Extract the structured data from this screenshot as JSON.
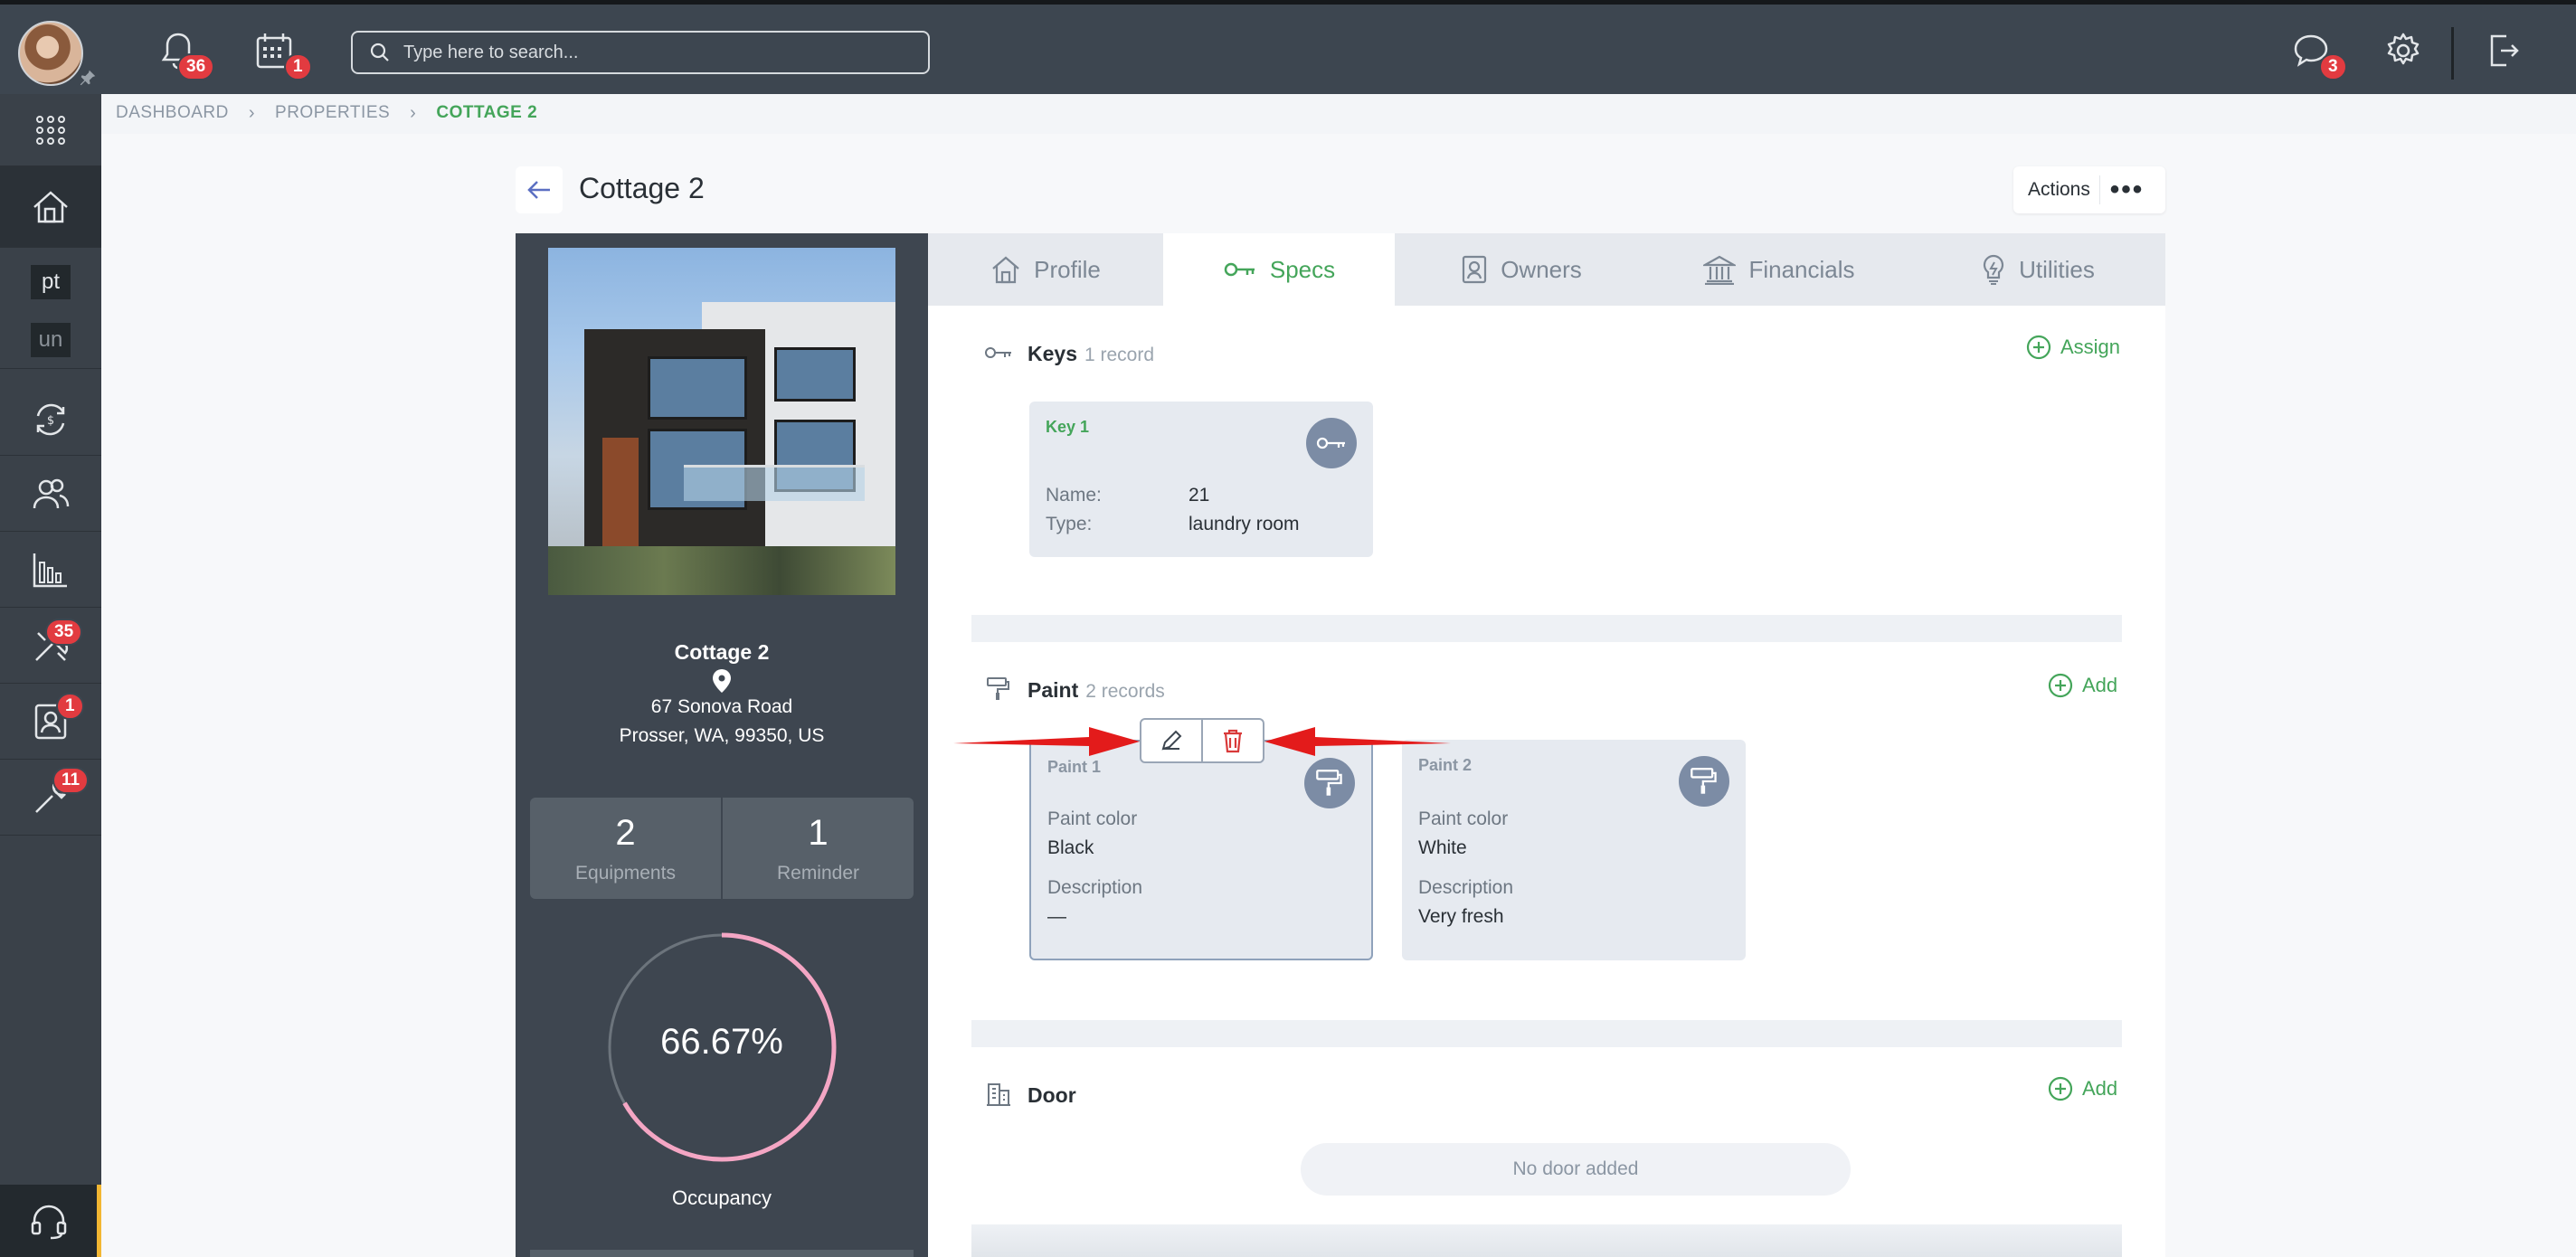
{
  "topbar": {
    "notifications_count": "36",
    "calendar_count": "1",
    "search_placeholder": "Type here to search...",
    "messages_count": "3"
  },
  "sidebar": {
    "pt_label": "pt",
    "un_label": "un",
    "maintenance_count": "35",
    "contacts_count": "1",
    "tools_count": "11"
  },
  "breadcrumb": {
    "items": [
      "DASHBOARD",
      "PROPERTIES",
      "COTTAGE 2"
    ]
  },
  "header": {
    "title": "Cottage 2",
    "actions_label": "Actions",
    "more_label": "•••"
  },
  "property": {
    "name": "Cottage 2",
    "address_line1": "67 Sonova Road",
    "address_line2": "Prosser, WA, 99350, US",
    "equipments_count": "2",
    "equipments_label": "Equipments",
    "reminder_count": "1",
    "reminder_label": "Reminder",
    "occupancy_value": "66.67%",
    "occupancy_fraction": 0.6667,
    "occupancy_label": "Occupancy"
  },
  "tabs": [
    {
      "label": "Profile"
    },
    {
      "label": "Specs"
    },
    {
      "label": "Owners"
    },
    {
      "label": "Financials"
    },
    {
      "label": "Utilities"
    }
  ],
  "keys": {
    "title": "Keys",
    "count": "1 record",
    "action": "Assign",
    "cards": [
      {
        "title": "Key 1",
        "name_label": "Name:",
        "name_value": "21",
        "type_label": "Type:",
        "type_value": "laundry room"
      }
    ]
  },
  "paint": {
    "title": "Paint",
    "count": "2 records",
    "action": "Add",
    "cards": [
      {
        "title": "Paint 1",
        "color_label": "Paint color",
        "color_value": "Black",
        "desc_label": "Description",
        "desc_value": "—"
      },
      {
        "title": "Paint 2",
        "color_label": "Paint color",
        "color_value": "White",
        "desc_label": "Description",
        "desc_value": "Very fresh"
      }
    ]
  },
  "door": {
    "title": "Door",
    "action": "Add",
    "empty_text": "No door added"
  },
  "colors": {
    "accent_green": "#44a55a",
    "badge_red": "#e23b40",
    "annotation_red": "#e31b1b",
    "occupancy_pink": "#f4a6c4"
  }
}
